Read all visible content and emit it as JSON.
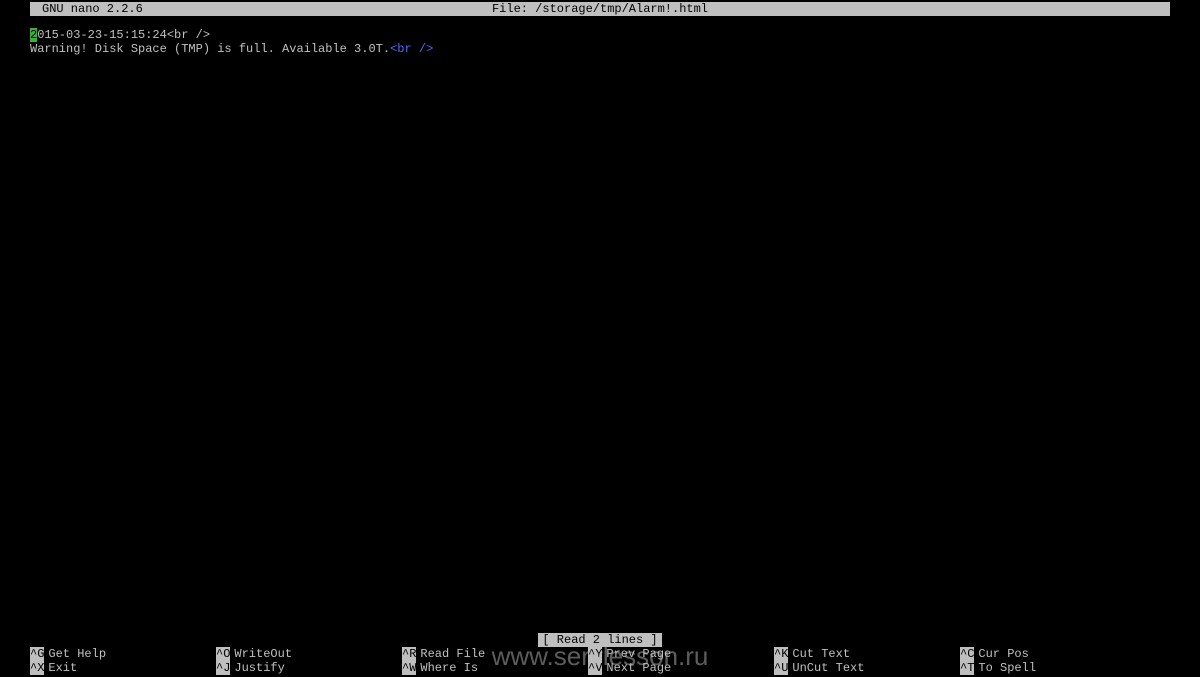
{
  "title": {
    "app": "GNU nano 2.2.6",
    "file_label": "File: /storage/tmp/Alarm!.html"
  },
  "content": {
    "cursor_char": "2",
    "line1_rest": "015-03-23-15:15:24<br />",
    "line2_text": "Warning! Disk Space (TMP) is full. Available 3.0T.",
    "line2_tag": "<br />"
  },
  "status": "[ Read 2 lines ]",
  "shortcuts": {
    "row1": [
      {
        "key": "^G",
        "label": "Get Help"
      },
      {
        "key": "^O",
        "label": "WriteOut"
      },
      {
        "key": "^R",
        "label": "Read File"
      },
      {
        "key": "^Y",
        "label": "Prev Page"
      },
      {
        "key": "^K",
        "label": "Cut Text"
      },
      {
        "key": "^C",
        "label": "Cur Pos"
      }
    ],
    "row2": [
      {
        "key": "^X",
        "label": "Exit"
      },
      {
        "key": "^J",
        "label": "Justify"
      },
      {
        "key": "^W",
        "label": "Where Is"
      },
      {
        "key": "^V",
        "label": "Next Page"
      },
      {
        "key": "^U",
        "label": "UnCut Text"
      },
      {
        "key": "^T",
        "label": "To Spell"
      }
    ]
  },
  "watermark": "www.servlesson.ru",
  "shortcut_columns": [
    0,
    186,
    372,
    558,
    744,
    930
  ]
}
